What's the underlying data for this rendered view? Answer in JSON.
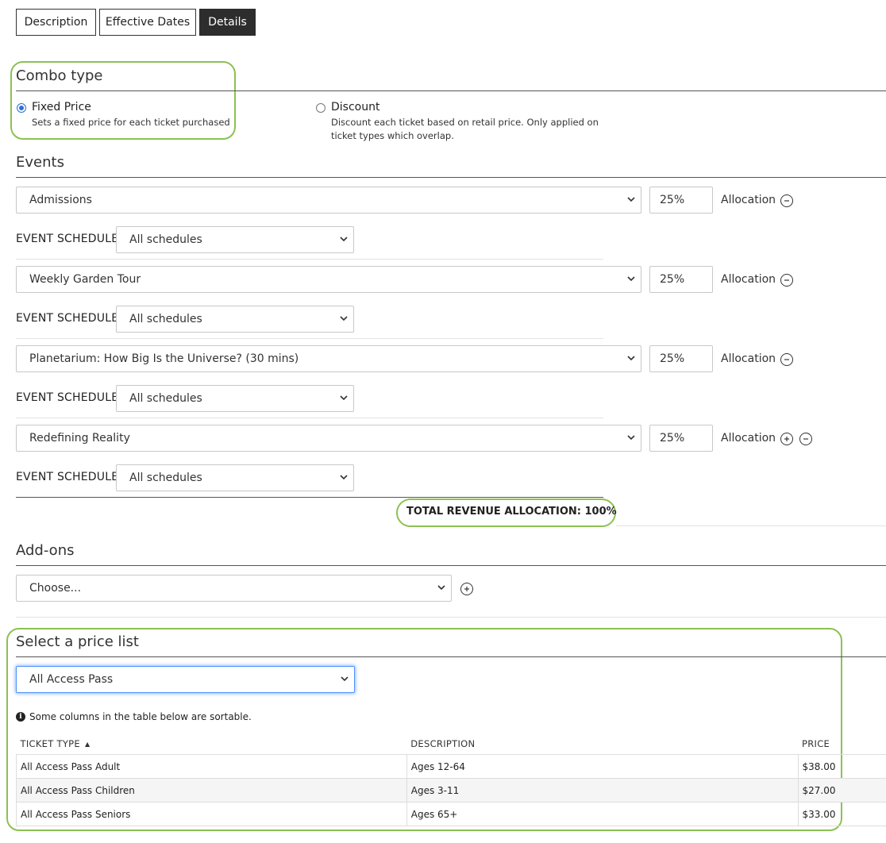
{
  "tabs": [
    {
      "label": "Description",
      "active": false
    },
    {
      "label": "Effective Dates",
      "active": false
    },
    {
      "label": "Details",
      "active": true
    }
  ],
  "combo_type": {
    "title": "Combo type",
    "options": [
      {
        "label": "Fixed Price",
        "description": "Sets a fixed price for each ticket purchased",
        "selected": true
      },
      {
        "label": "Discount",
        "description_line1": "Discount each ticket based on retail price. Only applied on",
        "description_line2": "ticket types which overlap.",
        "selected": false
      }
    ]
  },
  "events": {
    "title": "Events",
    "schedule_label": "EVENT SCHEDULE",
    "allocation_label": "Allocation",
    "items": [
      {
        "event": "Admissions",
        "allocation": "25%",
        "schedule": "All schedules"
      },
      {
        "event": "Weekly Garden Tour",
        "allocation": "25%",
        "schedule": "All schedules"
      },
      {
        "event": "Planetarium: How Big Is the Universe? (30 mins)",
        "allocation": "25%",
        "schedule": "All schedules"
      },
      {
        "event": "Redefining Reality",
        "allocation": "25%",
        "schedule": "All schedules"
      }
    ],
    "total_label": "TOTAL REVENUE ALLOCATION: 100%"
  },
  "addons": {
    "title": "Add-ons",
    "placeholder": "Choose..."
  },
  "price_list": {
    "title": "Select a price list",
    "selected": "All Access Pass",
    "note": "Some columns in the table below are sortable.",
    "columns": [
      "TICKET TYPE",
      "DESCRIPTION",
      "PRICE"
    ],
    "rows": [
      {
        "ticket_type": "All Access Pass Adult",
        "description": "Ages 12-64",
        "price": "$38.00"
      },
      {
        "ticket_type": "All Access Pass Children",
        "description": "Ages 3-11",
        "price": "$27.00"
      },
      {
        "ticket_type": "All Access Pass Seniors",
        "description": "Ages 65+",
        "price": "$33.00"
      }
    ]
  },
  "colors": {
    "highlight_green": "#8cc152",
    "focus_blue": "#4d90fe",
    "active_tab": "#2d2d2d"
  }
}
